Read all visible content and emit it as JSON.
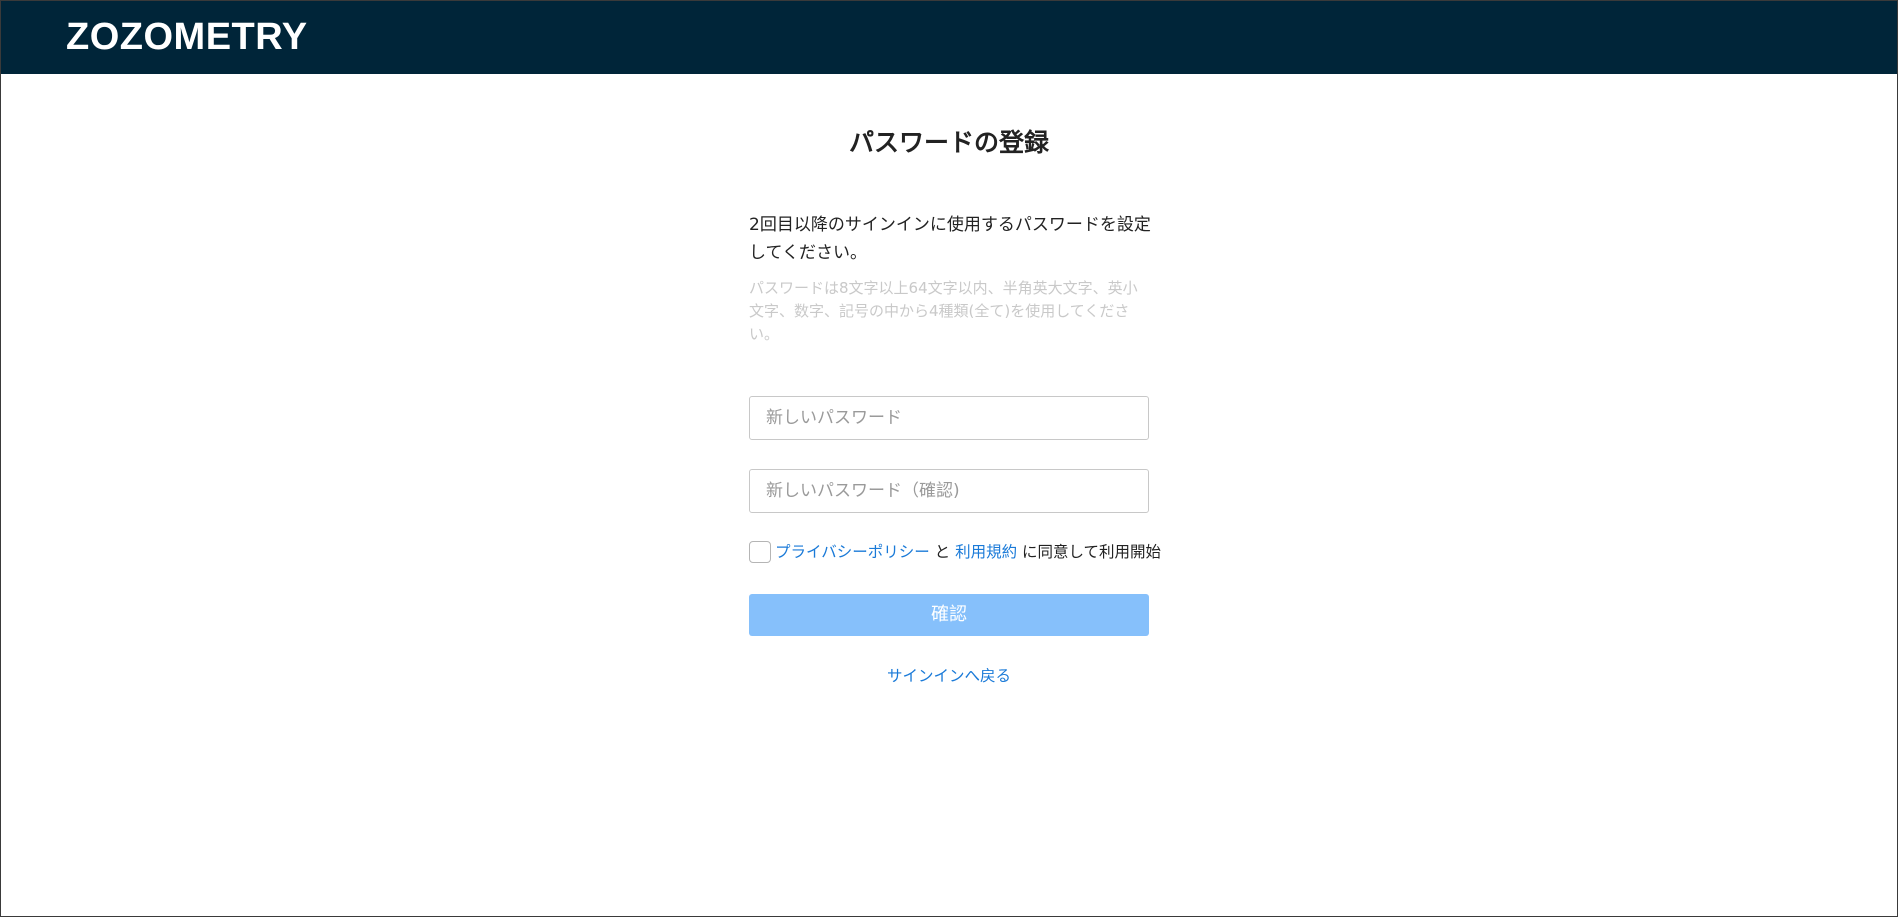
{
  "header": {
    "logo_text": "ZOZOMETRY"
  },
  "main": {
    "title": "パスワードの登録",
    "description": "2回目以降のサインインに使用するパスワードを設定してください。",
    "hint": "パスワードは8文字以上64文字以内、半角英大文字、英小文字、数字、記号の中から4種類(全て)を使用してください。",
    "new_password_placeholder": "新しいパスワード",
    "confirm_password_placeholder": "新しいパスワード（確認)",
    "agreement": {
      "privacy_link": "プライバシーポリシー",
      "connector": " と ",
      "terms_link": "利用規約",
      "suffix": " に同意して利用開始",
      "checked": false
    },
    "confirm_button": "確認",
    "back_link": "サインインへ戻る"
  },
  "colors": {
    "header_bg": "#002539",
    "link": "#1a7ad8",
    "button_bg_disabled": "#86c0fb",
    "hint_text": "#c9c9c9"
  }
}
